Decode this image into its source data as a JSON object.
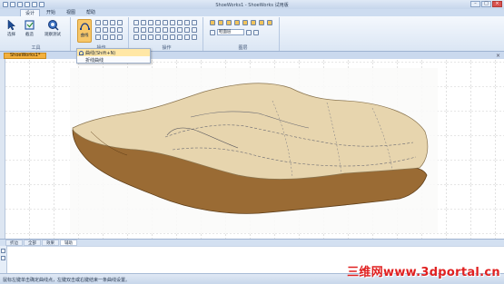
{
  "window": {
    "title": "ShoeWorks1 - ShoeWorks 试用版"
  },
  "ribbon": {
    "tabs": [
      "设计",
      "开始",
      "视图",
      "帮助"
    ],
    "active_tab": "设计",
    "groups": {
      "tools": {
        "label": "工具",
        "buttons": [
          "选择",
          "截造",
          "观察测试"
        ]
      },
      "edit": {
        "label": "操作",
        "curve_button": "曲线"
      },
      "operation": {
        "label": "操作"
      },
      "property": {
        "label": "图层",
        "layer_value": "鞋面层"
      }
    }
  },
  "dropdown": {
    "items": [
      "曲线(Shift+N)",
      "折线曲线"
    ]
  },
  "document": {
    "tab": "ShoeWorks1*"
  },
  "panel": {
    "tabs": [
      "折边",
      "全部",
      "效果",
      "辅助"
    ],
    "active_tab": "辅助"
  },
  "status": {
    "text": "鼠标左键单击确定曲线点，左键双击或右键结束一条曲线设置。"
  },
  "watermark": "三维网www.3dportal.cn",
  "colors": {
    "ribbon_bg": "#dbe6f4",
    "doc_tab": "#f3b03d",
    "watermark": "#e02020",
    "sole": "#9a6b34",
    "upper": "#e7d5ae"
  }
}
